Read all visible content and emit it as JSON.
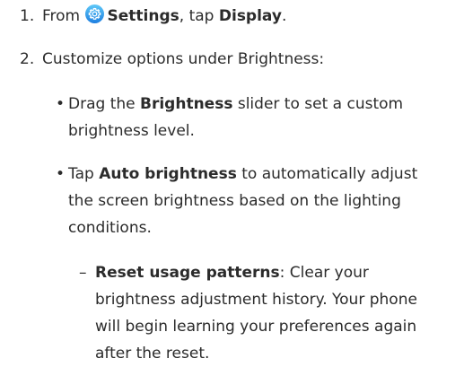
{
  "step1": {
    "number": "1.",
    "prefix": "From",
    "icon": "settings-gear-icon",
    "settings": "Settings",
    "comma_tap": ", tap",
    "display": "Display",
    "suffix": "."
  },
  "step2": {
    "number": "2.",
    "text": "Customize options under Brightness:"
  },
  "bullet1": {
    "marker": "•",
    "label": "Drag the",
    "bold": "Brightness",
    "rest_line1": "slider to set a custom",
    "rest_line2": "brightness level."
  },
  "bullet2": {
    "marker": "•",
    "lead": "Tap",
    "bold": "Auto brightness",
    "line1_rest": "to automatically adjust",
    "line2": "the screen brightness based on the lighting",
    "line3": "conditions."
  },
  "subitem": {
    "marker": "–",
    "bold": "Reset usage patterns",
    "line1_rest": ": Clear your",
    "line2": "brightness adjustment history. Your phone",
    "line3": "will begin learning your preferences again",
    "line4": "after the reset."
  },
  "colors": {
    "text": "#2b2b2b",
    "icon_gradient_top": "#4fc3f7",
    "icon_gradient_bottom": "#1e88e5"
  }
}
